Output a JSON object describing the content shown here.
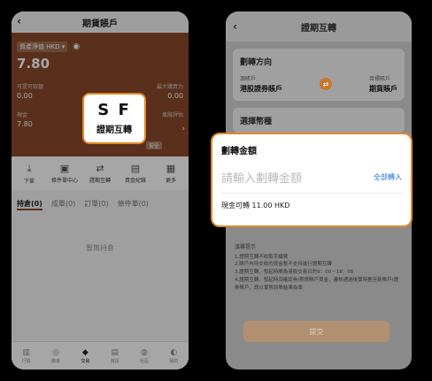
{
  "left": {
    "title": "期貨賬戶",
    "net_label": "資產淨值",
    "currency": "HKD",
    "net_value": "7.80",
    "stats_row1": [
      "可提可取額",
      "最大購買力"
    ],
    "stats_val1": [
      "0.00",
      "0.00"
    ],
    "stats_row2": [
      "現金",
      "風險評估"
    ],
    "stats_val2": [
      "7.80",
      ""
    ],
    "risk_badge": "安全",
    "actions": [
      {
        "icon": "download-icon",
        "label": "下單"
      },
      {
        "icon": "chart-icon",
        "label": "條件單中心"
      },
      {
        "icon": "transfer-icon",
        "label": "證期互轉"
      },
      {
        "icon": "receipt-icon",
        "label": "資金紀錄"
      },
      {
        "icon": "grid-icon",
        "label": "更多"
      }
    ],
    "tabs": [
      "持倉(0)",
      "成單(0)",
      "訂單(0)",
      "條件單(0)"
    ],
    "empty_text": "暫無持倉",
    "bottom_nav": [
      {
        "icon": "home-icon",
        "label": "行情"
      },
      {
        "icon": "compass-icon",
        "label": "機會"
      },
      {
        "icon": "trade-icon",
        "label": "交易"
      },
      {
        "icon": "news-icon",
        "label": "資訊"
      },
      {
        "icon": "community-icon",
        "label": "社區"
      },
      {
        "icon": "user-icon",
        "label": "我的"
      }
    ],
    "callout_icon": "S F",
    "callout_label": "證期互轉"
  },
  "right": {
    "title": "證期互轉",
    "direction_title": "劃轉方向",
    "from_label": "源賬戶",
    "from_value": "港股證券賬戶",
    "to_label": "目標賬戶",
    "to_value": "期貨賬戶",
    "currency_title": "選擇幣種",
    "notes_title": "溫馨提示",
    "notes": [
      "1.證期互轉不收取手續費",
      "2.賬戶內待交收的資金暫不支持進行證期互轉",
      "3.證期互轉，發起時間為港股交易日的9：00－18：00",
      "4.證期互轉，發起時須確認券/期貨賬戶資金，審核通過後實時劃至新賬戶(證券賬戶，請以實際到賬結果為準"
    ],
    "submit_label": "提交"
  },
  "float_card": {
    "title": "劃轉金額",
    "placeholder": "請輸入劃轉金額",
    "transfer_all": "全部轉入",
    "available": "現金可轉 11.00 HKD"
  }
}
